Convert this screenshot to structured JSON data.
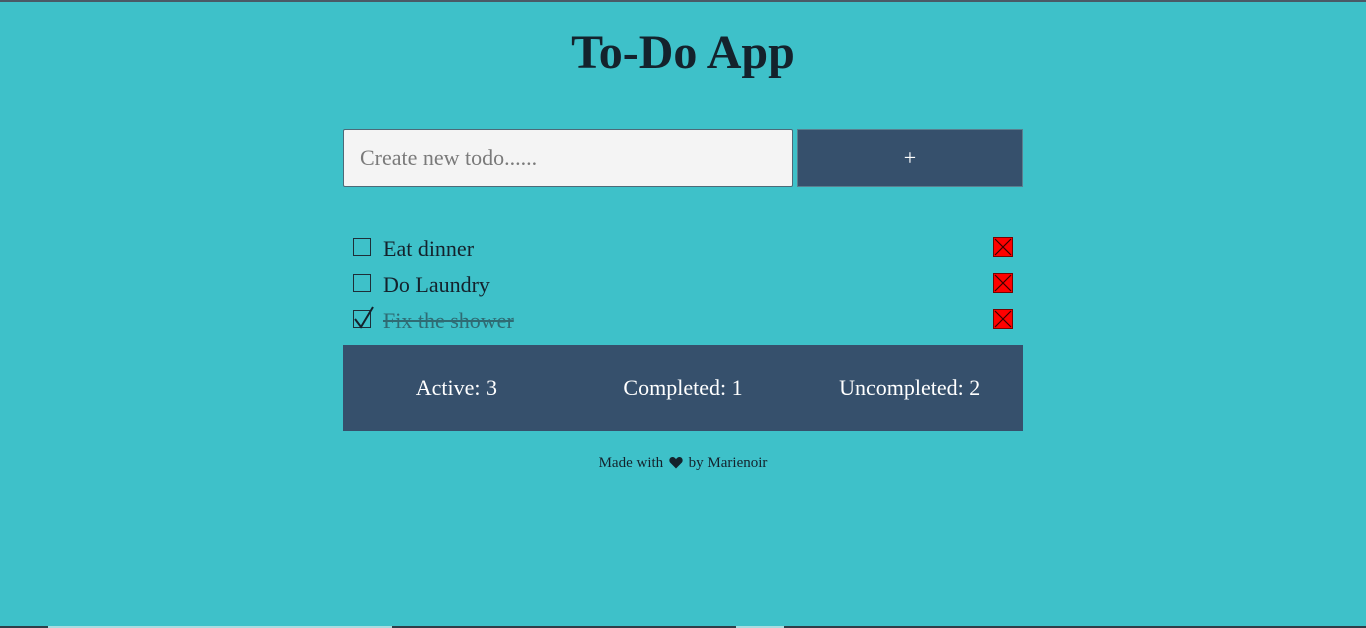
{
  "app": {
    "title": "To-Do App"
  },
  "new_todo": {
    "placeholder": "Create new todo......",
    "value": "",
    "add_label": "+"
  },
  "todos": [
    {
      "text": "Eat dinner",
      "completed": false
    },
    {
      "text": "Do Laundry",
      "completed": false
    },
    {
      "text": "Fix the shower",
      "completed": true
    }
  ],
  "stats": {
    "active": "Active: 3",
    "completed": "Completed: 1",
    "uncompleted": "Uncompleted: 2"
  },
  "footer": {
    "prefix": "Made with",
    "icon": "heart-icon",
    "suffix": "by Marienoir"
  },
  "colors": {
    "background": "#3ec1c9",
    "panel": "#36506c",
    "delete": "#ff0000",
    "input_bg": "#f4f4f4"
  }
}
